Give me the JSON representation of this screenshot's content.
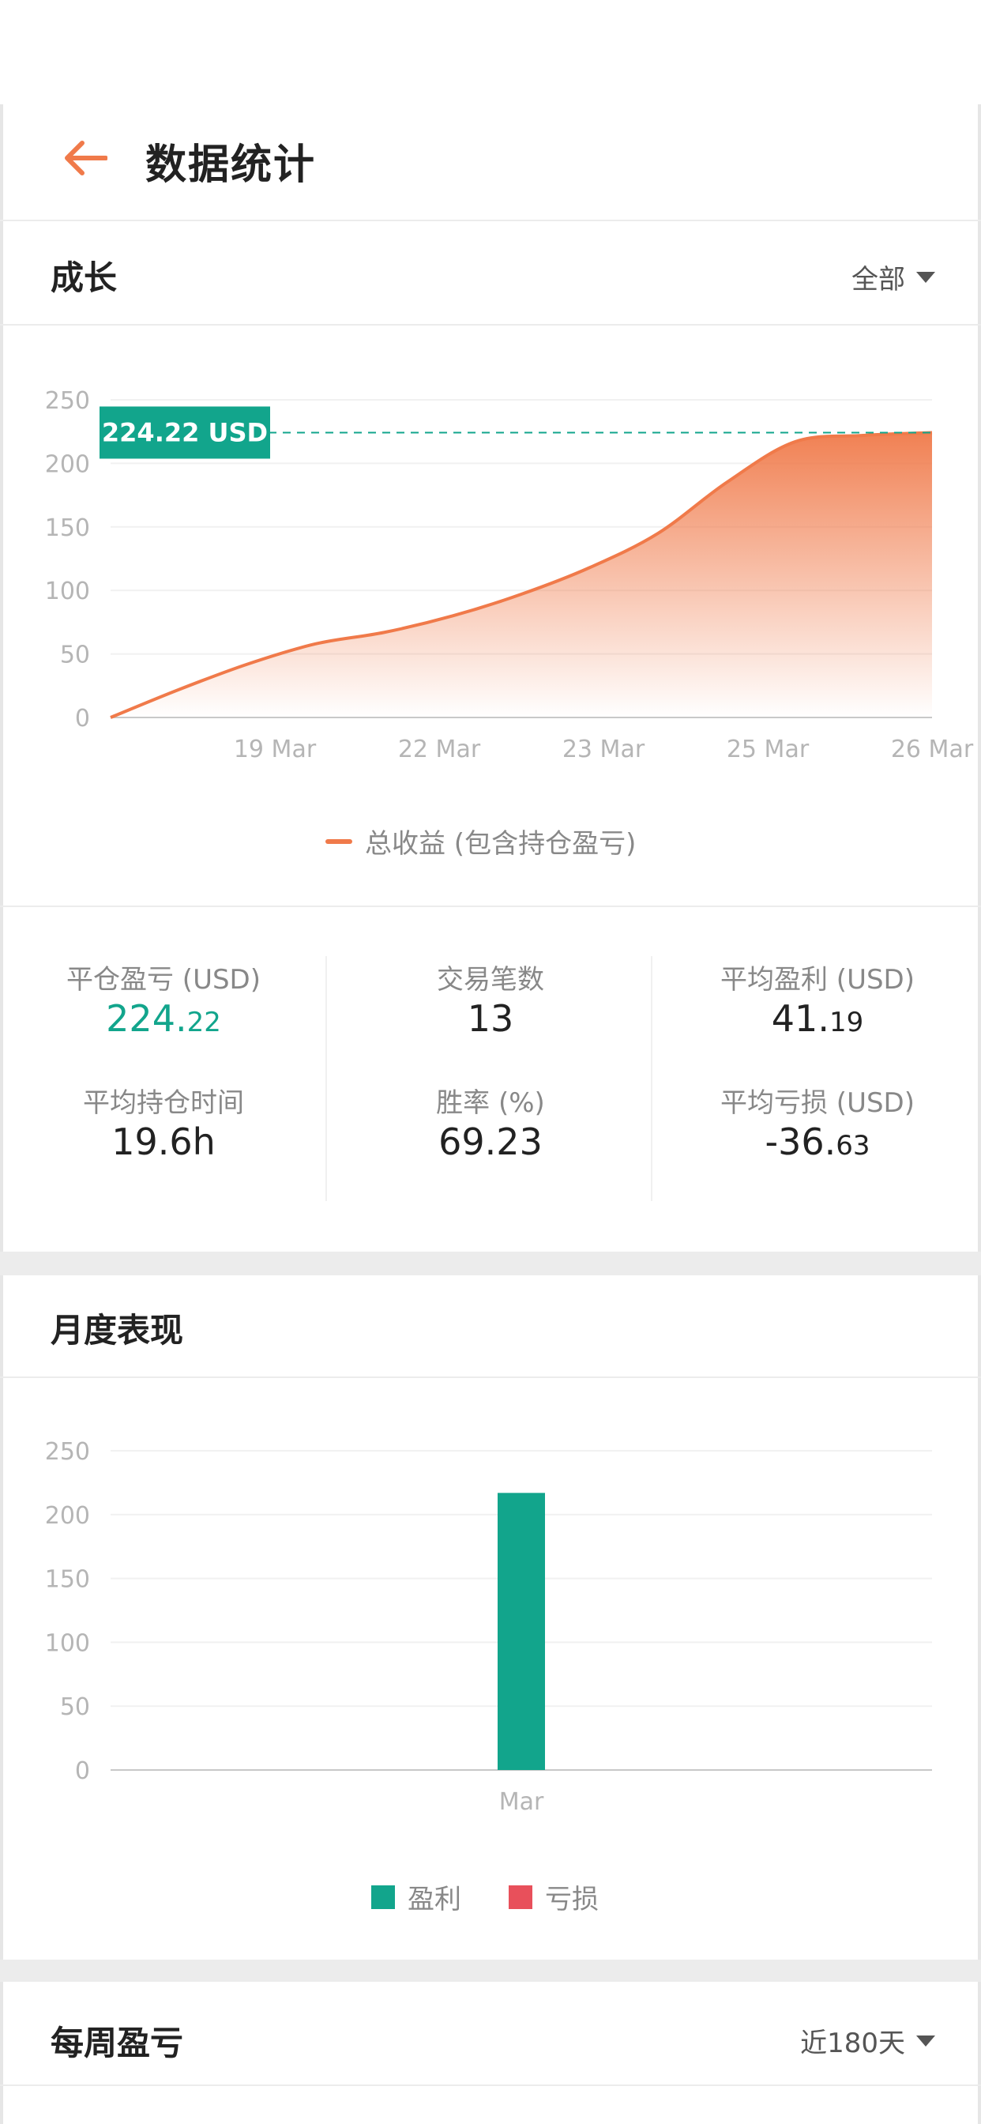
{
  "header": {
    "title": "数据统计"
  },
  "growth": {
    "title": "成长",
    "filter": "全部",
    "badge": "224.22 USD",
    "legend": "总收益 (包含持仓盈亏)"
  },
  "stats": {
    "closed_pnl": {
      "label": "平仓盈亏 (USD)",
      "int": "224.",
      "dec": "22"
    },
    "trade_count": {
      "label": "交易笔数",
      "value": "13"
    },
    "avg_profit": {
      "label": "平均盈利 (USD)",
      "int": "41.",
      "dec": "19"
    },
    "avg_hold": {
      "label": "平均持仓时间",
      "value": "19.6h"
    },
    "win_rate": {
      "label": "胜率 (%)",
      "value": "69.23"
    },
    "avg_loss": {
      "label": "平均亏损 (USD)",
      "int": "-36.",
      "dec": "63"
    }
  },
  "monthly": {
    "title": "月度表现",
    "legend_profit": "盈利",
    "legend_loss": "亏损"
  },
  "weekly": {
    "title": "每周盈亏",
    "filter": "近180天"
  },
  "colors": {
    "accent": "#f07a4a",
    "profit": "#12a58c",
    "loss": "#e8505b"
  },
  "chart_data": [
    {
      "type": "area",
      "ylim": [
        0,
        250
      ],
      "yticks": [
        "250",
        "200",
        "150",
        "100",
        "50",
        "0"
      ],
      "xticks": [
        "19 Mar",
        "22 Mar",
        "23 Mar",
        "25 Mar",
        "26 Mar"
      ],
      "series": [
        {
          "name": "总收益 (包含持仓盈亏)",
          "values": [
            0,
            22,
            42,
            58,
            67,
            80,
            97,
            118,
            145,
            185,
            217,
            222,
            224.22
          ]
        }
      ]
    },
    {
      "type": "bar",
      "ylim": [
        0,
        250
      ],
      "yticks": [
        "250",
        "200",
        "150",
        "100",
        "50",
        "0"
      ],
      "categories": [
        "Mar"
      ],
      "series": [
        {
          "name": "盈利",
          "values": [
            217
          ]
        },
        {
          "name": "亏损",
          "values": [
            0
          ]
        }
      ]
    }
  ]
}
